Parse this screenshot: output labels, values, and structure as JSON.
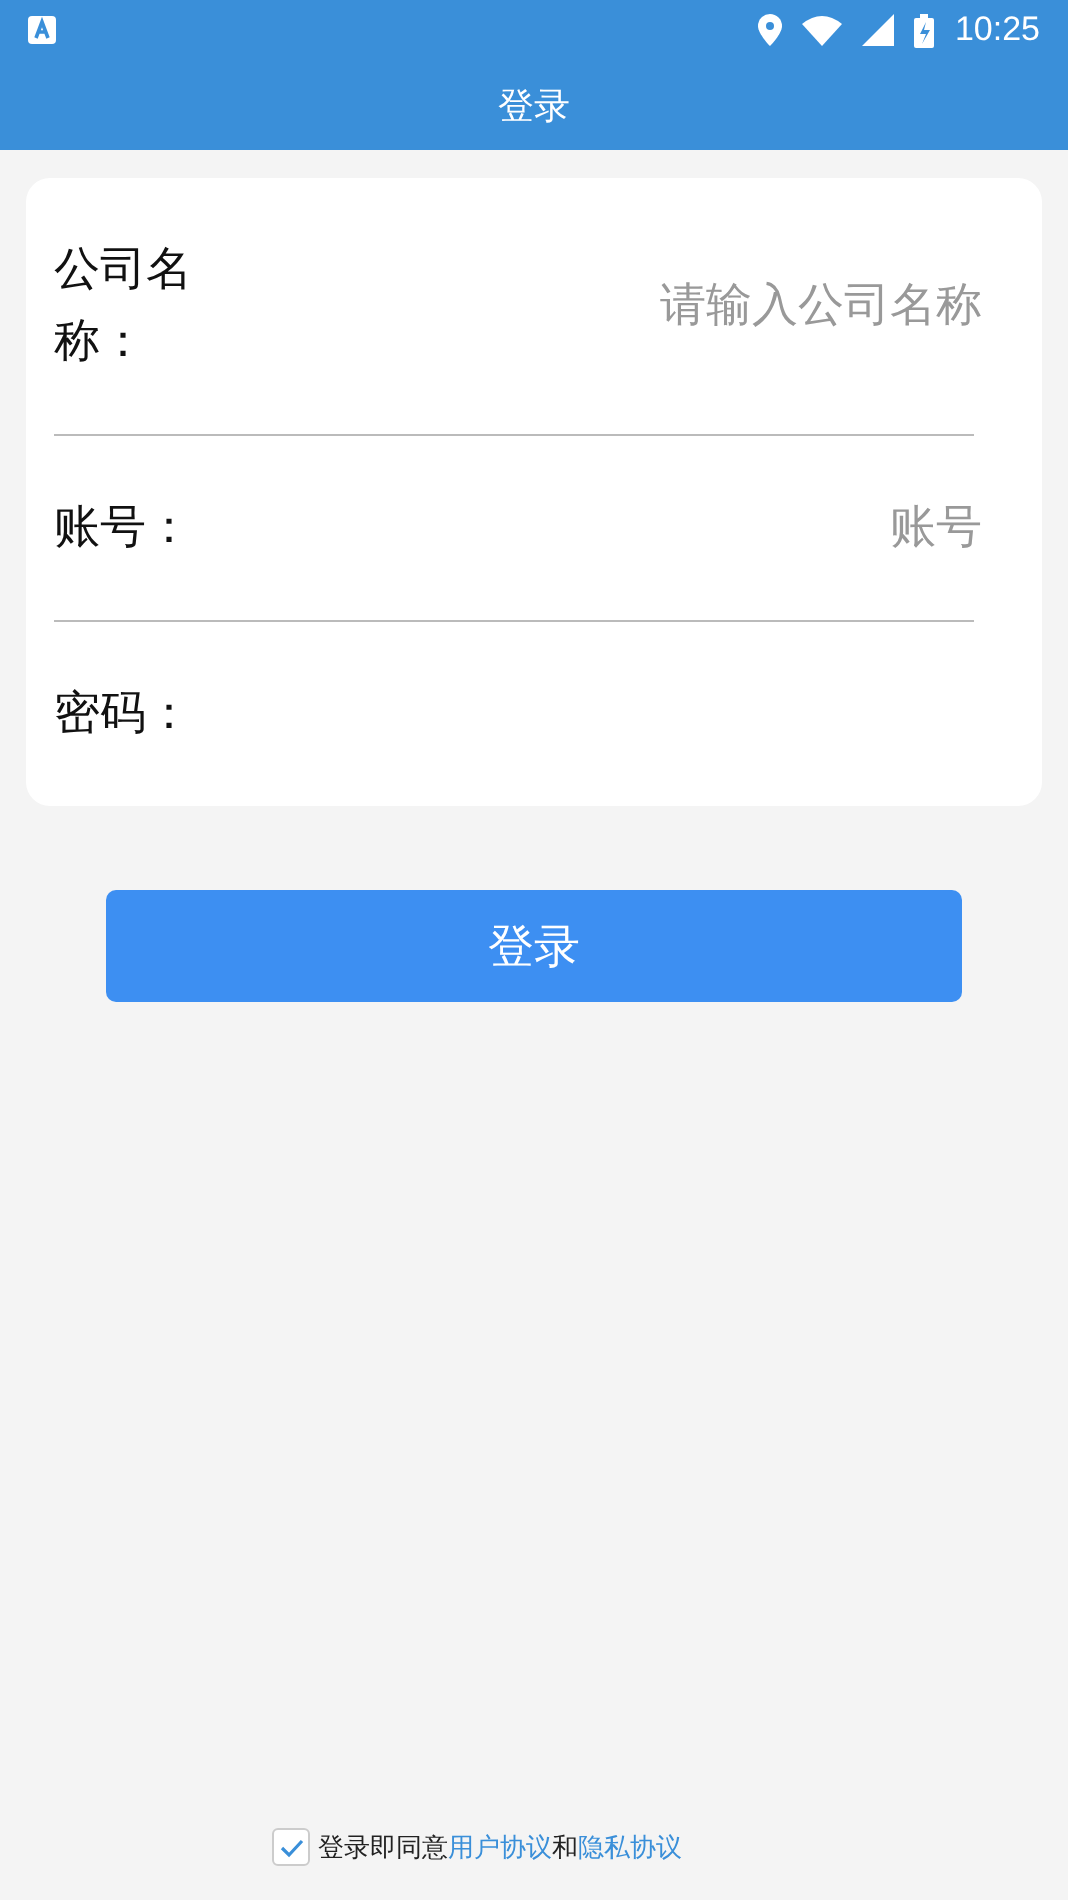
{
  "status_bar": {
    "time": "10:25"
  },
  "title": "登录",
  "fields": [
    {
      "label": "公司名称：",
      "placeholder": "请输入公司名称"
    },
    {
      "label": "账号：",
      "placeholder": "账号"
    },
    {
      "label": "密码："
    }
  ],
  "login_button": "登录",
  "agreement": {
    "checked": true,
    "text": "登录即同意",
    "link_1": "用户协议",
    "joiner": "和",
    "link_2": "隐私协议"
  }
}
